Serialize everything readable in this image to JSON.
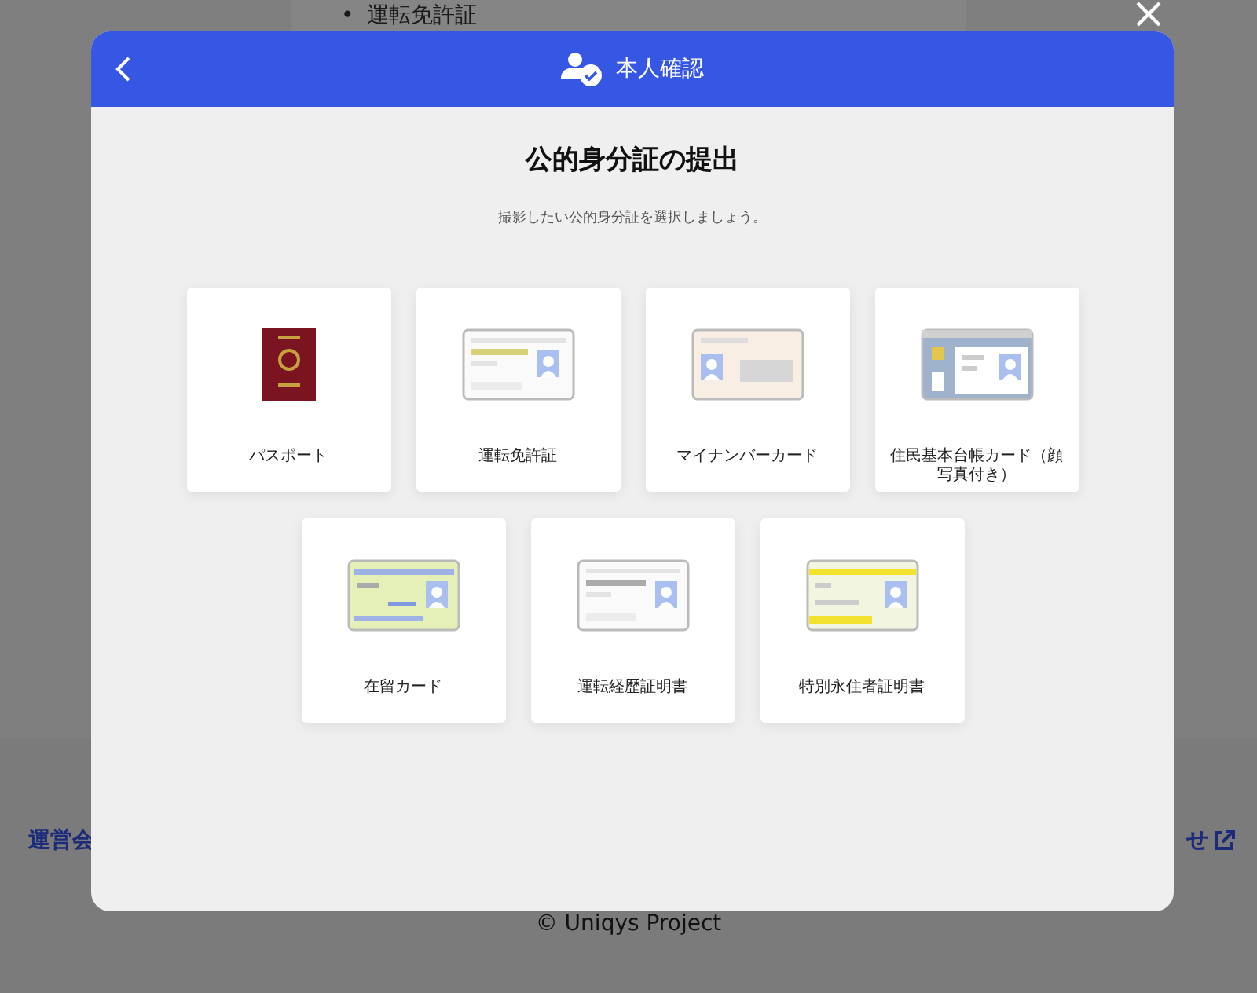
{
  "background_page": {
    "bullet_items": [
      {
        "marker": "•",
        "text": "運転免許証"
      }
    ],
    "footer_links": [
      {
        "label": "運営会",
        "external": false
      },
      {
        "label": "せ",
        "external": true
      }
    ],
    "copyright": "© Uniqys Project"
  },
  "dialog": {
    "title": "本人確認",
    "heading": "公的身分証の提出",
    "subtitle": "撮影したい公的身分証を選択しましょう。",
    "options": [
      {
        "label": "パスポート"
      },
      {
        "label": "運転免許証"
      },
      {
        "label": "マイナンバーカード"
      },
      {
        "label": "住民基本台帳カード（顔写真付き）"
      },
      {
        "label": "在留カード"
      },
      {
        "label": "運転経歴証明書"
      },
      {
        "label": "特別永住者証明書"
      }
    ]
  }
}
